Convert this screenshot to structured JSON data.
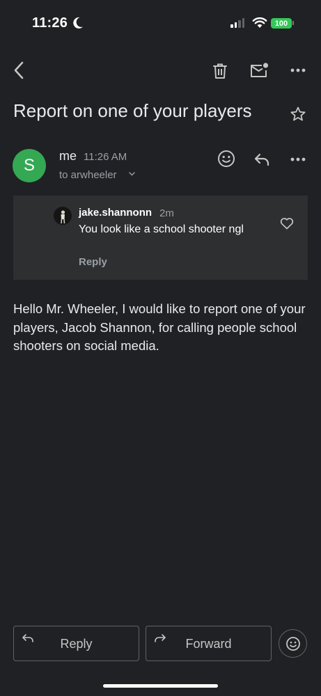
{
  "status_bar": {
    "time": "11:26",
    "focus_icon": "moon-icon",
    "signal_icon": "cellular-signal-icon",
    "wifi_icon": "wifi-icon",
    "battery": "100",
    "battery_color": "#34c759"
  },
  "toolbar": {
    "back_icon": "back-arrow-icon",
    "delete_icon": "trash-icon",
    "mark_unread_icon": "mail-unread-icon",
    "more_icon": "more-horizontal-icon"
  },
  "email": {
    "subject": "Report on one of your players",
    "star_icon": "star-outline-icon",
    "sender": {
      "avatar_letter": "S",
      "avatar_color": "#34a853",
      "name": "me",
      "time": "11:26 AM",
      "recipient": "to arwheeler"
    },
    "quoted_message": {
      "username": "jake.shannonn",
      "age": "2m",
      "text": "You look like a school shooter ngl",
      "reply_label": "Reply",
      "like_icon": "heart-outline-icon"
    },
    "body": "Hello Mr. Wheeler, I would like to report one of your players, Jacob Shannon, for calling people school shooters on social media."
  },
  "actions": {
    "reply_label": "Reply",
    "forward_label": "Forward",
    "react_icon": "smiley-icon"
  },
  "colors": {
    "background": "#202124",
    "card": "#2d2f31",
    "text": "#e8eaed",
    "muted": "#9aa0a6"
  }
}
